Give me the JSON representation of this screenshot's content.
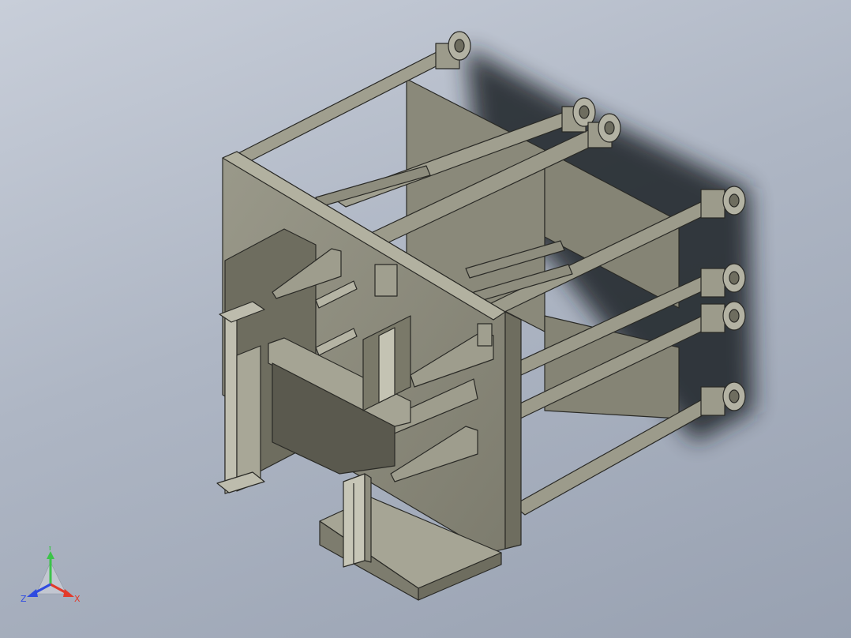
{
  "viewport": {
    "background_top": "#c8ced9",
    "background_bottom": "#98a1b1"
  },
  "model": {
    "body_color": "#8f8e7e",
    "body_light": "#a3a291",
    "body_dark": "#6e6d5f",
    "edge_color": "#2a2a26",
    "shadow_color": "#1e2127"
  },
  "triad": {
    "x_label": "X",
    "y_label": "Y",
    "z_label": "Z",
    "x_color": "#e23a2a",
    "y_color": "#3cc34a",
    "z_color": "#2f4be0"
  }
}
